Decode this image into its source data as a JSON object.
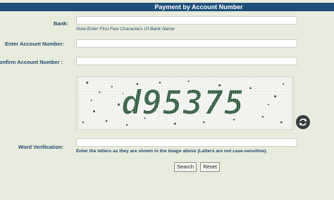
{
  "header": {
    "title": "Payment by Account Number"
  },
  "form": {
    "bank_label": "Bank:",
    "bank_value": "",
    "bank_note": "Note:Enter First Few Characters Of Bank Name",
    "account_label": "Enter Account Number:",
    "account_value": "",
    "confirm_label": "onfirm Account Number :",
    "confirm_value": "",
    "captcha_text": "d95375",
    "refresh_icon": "refresh-icon",
    "word_label": "Word Verification:",
    "word_value": "",
    "word_hint": "Enter the letters as they are shown in the image above (Letters are not case-sensitive)."
  },
  "buttons": {
    "search": "Search",
    "reset": "Reset"
  },
  "colors": {
    "header_bg": "#1f4f7a",
    "label_text": "#1f4a6f",
    "page_bg": "#e8ecdc",
    "captcha_text": "#2e5a3c"
  }
}
